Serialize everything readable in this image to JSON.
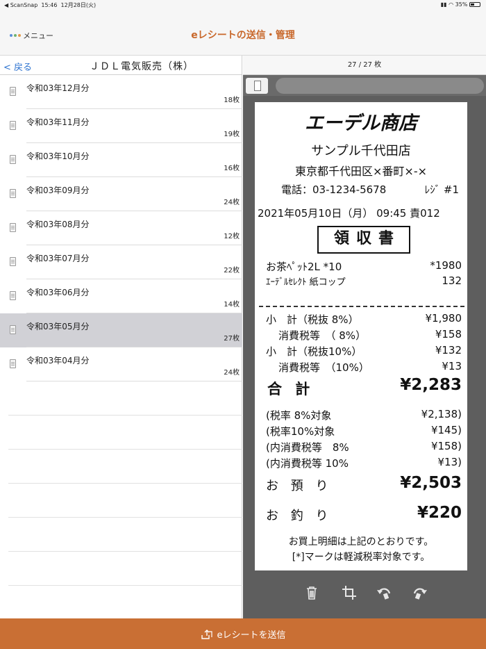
{
  "status": {
    "carrier": "◀ ScanSnap",
    "time": "15:46",
    "date": "12月28日(火)",
    "battery": "35%"
  },
  "nav": {
    "menu_label": "メニュー",
    "title": "eレシートの送信・管理"
  },
  "left": {
    "back_label": "< 戻る",
    "company": "ＪＤＬ電気販売（株）",
    "items": [
      {
        "label": "令和03年12月分",
        "count": "18枚"
      },
      {
        "label": "令和03年11月分",
        "count": "19枚"
      },
      {
        "label": "令和03年10月分",
        "count": "16枚"
      },
      {
        "label": "令和03年09月分",
        "count": "24枚"
      },
      {
        "label": "令和03年08月分",
        "count": "12枚"
      },
      {
        "label": "令和03年07月分",
        "count": "22枚"
      },
      {
        "label": "令和03年06月分",
        "count": "14枚"
      },
      {
        "label": "令和03年05月分",
        "count": "27枚",
        "selected": true
      },
      {
        "label": "令和03年04月分",
        "count": "24枚"
      }
    ]
  },
  "right": {
    "page_counter": "27 / 27 枚",
    "receipt": {
      "store": "エーデル商店",
      "branch": "サンプル千代田店",
      "address": "東京都千代田区×番町×-×",
      "tel": "電話：03-1234-5678",
      "register": "ﾚｼﾞ #1",
      "datetime": "2021年05月10日（月） 09:45 責012",
      "doc_title": "領収書",
      "item1_name": "お茶ﾍﾟｯﾄ2L *10",
      "item1_price": "*1980",
      "item2_name": "ｴｰﾃﾞﾙｾﾚｸﾄ 紙コップ",
      "item2_price": "132",
      "sub8_label": "小　計（税抜 8%）",
      "sub8_value": "¥1,980",
      "tax8_label": "消費税等　（ 8%）",
      "tax8_value": "¥158",
      "sub10_label": "小　計（税抜10%）",
      "sub10_value": "¥132",
      "tax10_label": "消費税等　（10%）",
      "tax10_value": "¥13",
      "total_label": "合 計",
      "total_value": "¥2,283",
      "rate8_label": "(税率 8%対象",
      "rate8_value": "¥2,138)",
      "rate10_label": "(税率10%対象",
      "rate10_value": "¥145)",
      "intax8_label": "(内消費税等　8%",
      "intax8_value": "¥158)",
      "intax10_label": "(内消費税等 10%",
      "intax10_value": "¥13)",
      "deposit_label": "お 預 り",
      "deposit_value": "¥2,503",
      "change_label": "お 釣 り",
      "change_value": "¥220",
      "footer1": "お買上明細は上記のとおりです。",
      "footer2": "[*]マークは軽減税率対象です。"
    }
  },
  "bottom": {
    "send_label": "eレシートを送信"
  },
  "colors": {
    "accent": "#c96f34",
    "link": "#2f74d0",
    "selected_row": "#d1d1d6"
  }
}
